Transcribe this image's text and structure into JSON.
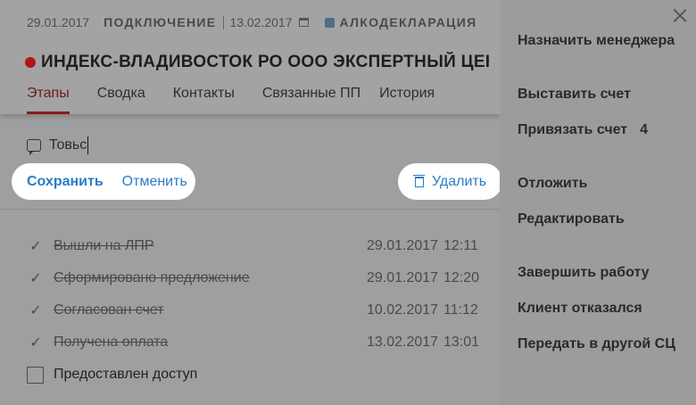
{
  "header": {
    "date_created": "29.01.2017",
    "status": "ПОДКЛЮЧЕНИЕ",
    "status_date": "13.02.2017",
    "product": "АЛКОДЕКЛАРАЦИЯ",
    "title": "ИНДЕКС-ВЛАДИВОСТОК РО ООО ЭКСПЕРТНЫЙ ЦЕНТР ИН",
    "status_dot_color": "#b3141a"
  },
  "tabs": [
    {
      "label": "Этапы",
      "active": true
    },
    {
      "label": "Сводка",
      "active": false
    },
    {
      "label": "Контакты",
      "active": false
    },
    {
      "label": "Связанные ПП",
      "active": false
    },
    {
      "label": "История",
      "active": false
    }
  ],
  "comment": {
    "value": "Товьс",
    "icon": "comment-icon"
  },
  "actions": {
    "save_label": "Сохранить",
    "cancel_label": "Отменить",
    "delete_label": "Удалить",
    "accent_color": "#2a7cc7"
  },
  "stages": [
    {
      "label": "Вышли на ЛПР",
      "date": "29.01.2017",
      "time": "12:11",
      "done": true
    },
    {
      "label": "Сформировано предложение",
      "date": "29.01.2017",
      "time": "12:20",
      "done": true
    },
    {
      "label": "Согласован счет",
      "date": "10.02.2017",
      "time": "11:12",
      "done": true
    },
    {
      "label": "Получена оплата",
      "date": "13.02.2017",
      "time": "13:01",
      "done": true
    },
    {
      "label": "Предоставлен доступ",
      "date": "",
      "time": "",
      "done": false
    }
  ],
  "side_menu": {
    "assign_manager": "Назначить менеджера",
    "issue_invoice": "Выставить счет",
    "link_invoice": "Привязать счет",
    "link_invoice_count": "4",
    "postpone": "Отложить",
    "edit": "Редактировать",
    "finish_work": "Завершить работу",
    "client_refused": "Клиент отказался",
    "transfer": "Передать в другой СЦ"
  }
}
